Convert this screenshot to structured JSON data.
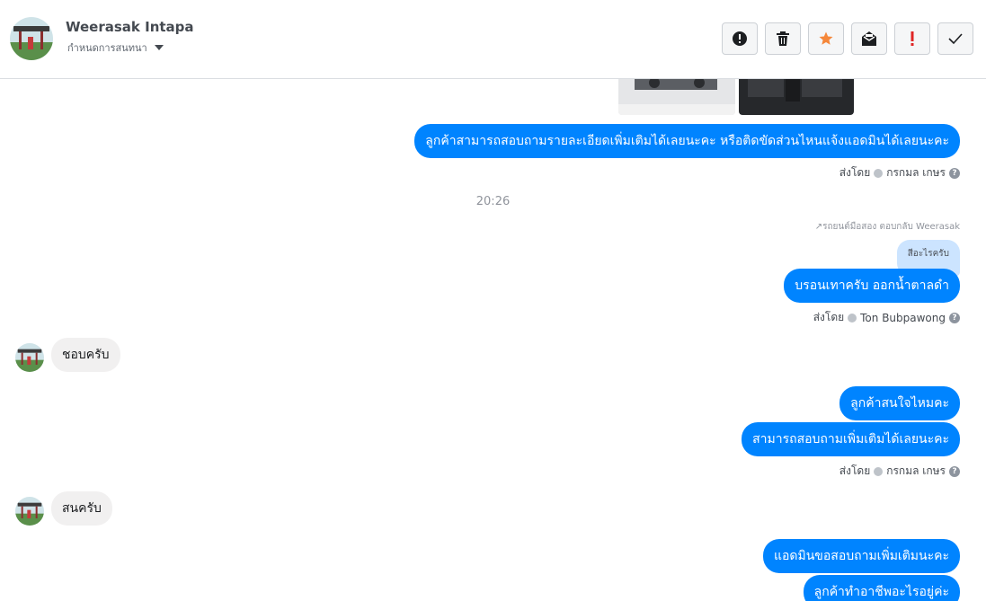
{
  "header": {
    "name": "Weerasak Intapa",
    "subtitle": "กำหนดการสนทนา",
    "actions": [
      {
        "name": "report-button",
        "icon": "alert-icon"
      },
      {
        "name": "delete-button",
        "icon": "trash-icon"
      },
      {
        "name": "star-button",
        "icon": "star-icon"
      },
      {
        "name": "mark-unread-button",
        "icon": "envelope-icon"
      },
      {
        "name": "spam-button",
        "icon": "exclamation-icon"
      },
      {
        "name": "done-button",
        "icon": "check-icon"
      }
    ],
    "accent_star": "#f5873a",
    "accent_alert": "#e02525"
  },
  "thread": {
    "msg1": "ลูกค้าสามารถสอบถามรายละเอียดเพิ่มเติมได้เลยนะคะ หรือติดขัดส่วนไหนแจ้งแอดมินได้เลยนะคะ",
    "sent_by_label": "ส่งโดย",
    "sender1": "กรกมล เกษร",
    "time": "20:26",
    "reply_hint": "รถยนต์มือสอง ตอบกลับ Weerasak",
    "quoted": "สีอะไรครับ",
    "msg2": "บรอนเทาครับ ออกน้ำตาลดำ",
    "sender2": "Ton Bubpawong",
    "in1": "ชอบครับ",
    "msg3": "ลูกค้าสนใจไหมคะ",
    "msg4": "สามารถสอบถามเพิ่มเติมได้เลยนะคะ",
    "sender3": "กรกมล เกษร",
    "in2": "สนครับ",
    "msg5": "แอดมินขอสอบถามเพิ่มเติมนะคะ",
    "msg6": "ลูกค้าทำอาชีพอะไรอยู่ค่ะ",
    "bubble_color": "#0084ff"
  }
}
